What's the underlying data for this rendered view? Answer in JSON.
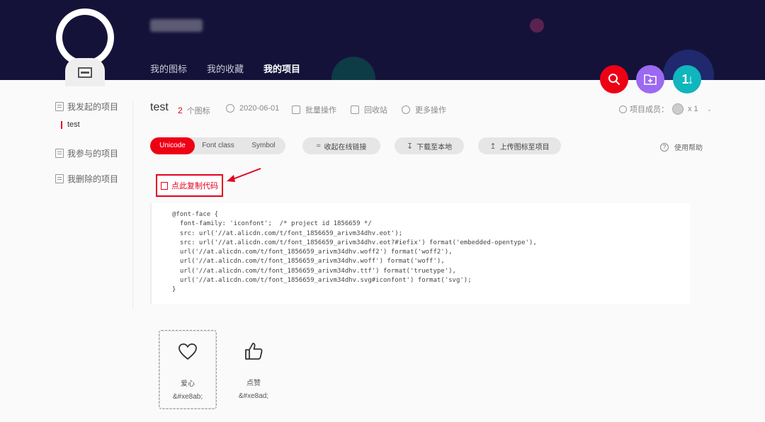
{
  "header": {
    "nav": [
      "我的图标",
      "我的收藏",
      "我的项目"
    ],
    "active_nav": "我的项目"
  },
  "fab": {
    "search_icon": "search-icon",
    "add_project_icon": "folder-add-icon",
    "sort_label": "1↓"
  },
  "sidebar": {
    "items": [
      {
        "label": "我发起的项目",
        "icon": "document-icon"
      },
      {
        "label": "我参与的项目",
        "icon": "document-icon"
      },
      {
        "label": "我删除的项目",
        "icon": "document-icon"
      }
    ],
    "sub_items": [
      "test"
    ]
  },
  "project": {
    "title": "test",
    "icon_count": "2",
    "icon_count_suffix": "个图标",
    "date": "2020-06-01",
    "batch": "批量操作",
    "recycle": "回收站",
    "more": "更多操作",
    "members_label": "项目成员：",
    "members_count": "x 1"
  },
  "tabs": [
    "Unicode",
    "Font class",
    "Symbol"
  ],
  "active_tab": "Unicode",
  "buttons": {
    "collapse_link": "收起在线链接",
    "download": "下载至本地",
    "upload": "上传图标至项目",
    "help": "使用帮助",
    "copy_code": "点此复制代码"
  },
  "code_lines": [
    "@font-face {",
    "  font-family: 'iconfont';  /* project id 1856659 */",
    "  src: url('//at.alicdn.com/t/font_1856659_arivm34dhv.eot');",
    "  src: url('//at.alicdn.com/t/font_1856659_arivm34dhv.eot?#iefix') format('embedded-opentype'),",
    "  url('//at.alicdn.com/t/font_1856659_arivm34dhv.woff2') format('woff2'),",
    "  url('//at.alicdn.com/t/font_1856659_arivm34dhv.woff') format('woff'),",
    "  url('//at.alicdn.com/t/font_1856659_arivm34dhv.ttf') format('truetype'),",
    "  url('//at.alicdn.com/t/font_1856659_arivm34dhv.svg#iconfont') format('svg');",
    "}"
  ],
  "icons": [
    {
      "name": "爱心",
      "code": "&#xe8ab;",
      "icon": "heart-icon"
    },
    {
      "name": "点赞",
      "code": "&#xe8ad;",
      "icon": "thumbs-up-icon"
    }
  ],
  "colors": {
    "header_bg": "#15123a",
    "accent_red": "#ee0015",
    "purple": "#9b69f2",
    "teal": "#10b5bd"
  }
}
